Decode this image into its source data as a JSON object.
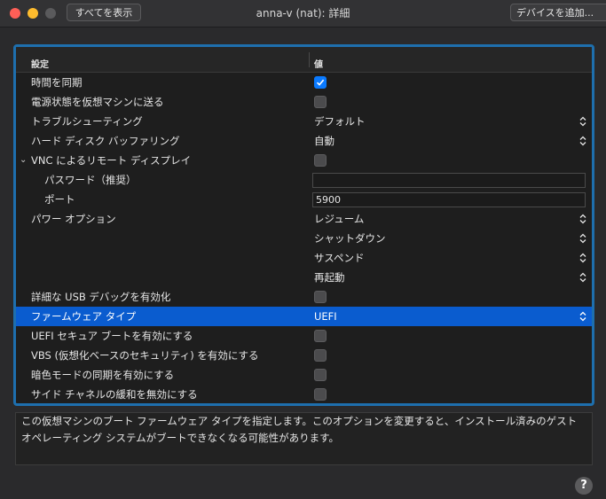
{
  "titlebar": {
    "show_all_label": "すべてを表示",
    "window_title": "anna-v (nat): 詳細",
    "add_device_label": "デバイスを追加..."
  },
  "table": {
    "header": {
      "setting": "設定",
      "value": "値"
    },
    "rows": [
      {
        "label": "時間を同期",
        "type": "checkbox",
        "checked": true
      },
      {
        "label": "電源状態を仮想マシンに送る",
        "type": "checkbox",
        "checked": false
      },
      {
        "label": "トラブルシューティング",
        "type": "popup",
        "value": "デフォルト"
      },
      {
        "label": "ハード ディスク バッファリング",
        "type": "popup",
        "value": "自動"
      },
      {
        "label": "VNC によるリモート ディスプレイ",
        "type": "checkbox",
        "checked": false,
        "expanded": true
      },
      {
        "label": "パスワード（推奨）",
        "type": "text",
        "value": ""
      },
      {
        "label": "ポート",
        "type": "text",
        "value": "5900"
      },
      {
        "label": "パワー オプション",
        "type": "popup",
        "value": "レジューム"
      },
      {
        "label": "",
        "type": "popup",
        "value": "シャットダウン"
      },
      {
        "label": "",
        "type": "popup",
        "value": "サスペンド"
      },
      {
        "label": "",
        "type": "popup",
        "value": "再起動"
      },
      {
        "label": "詳細な USB デバッグを有効化",
        "type": "checkbox",
        "checked": false
      },
      {
        "label": "ファームウェア タイプ",
        "type": "popup",
        "value": "UEFI",
        "selected": true
      },
      {
        "label": "UEFI セキュア ブートを有効にする",
        "type": "checkbox",
        "checked": false
      },
      {
        "label": "VBS (仮想化ベースのセキュリティ) を有効にする",
        "type": "checkbox",
        "checked": false
      },
      {
        "label": "暗色モードの同期を有効にする",
        "type": "checkbox",
        "checked": false
      },
      {
        "label": "サイド チャネルの緩和を無効にする",
        "type": "checkbox",
        "checked": false
      }
    ]
  },
  "description": "この仮想マシンのブート ファームウェア タイプを指定します。このオプションを変更すると、インストール済みのゲスト オペレーティング システムがブートできなくなる可能性があります。",
  "help_label": "?",
  "colors": {
    "accent": "#0a5ccf",
    "focus_ring": "#1e6fae",
    "checkbox_checked": "#0a7aff"
  }
}
